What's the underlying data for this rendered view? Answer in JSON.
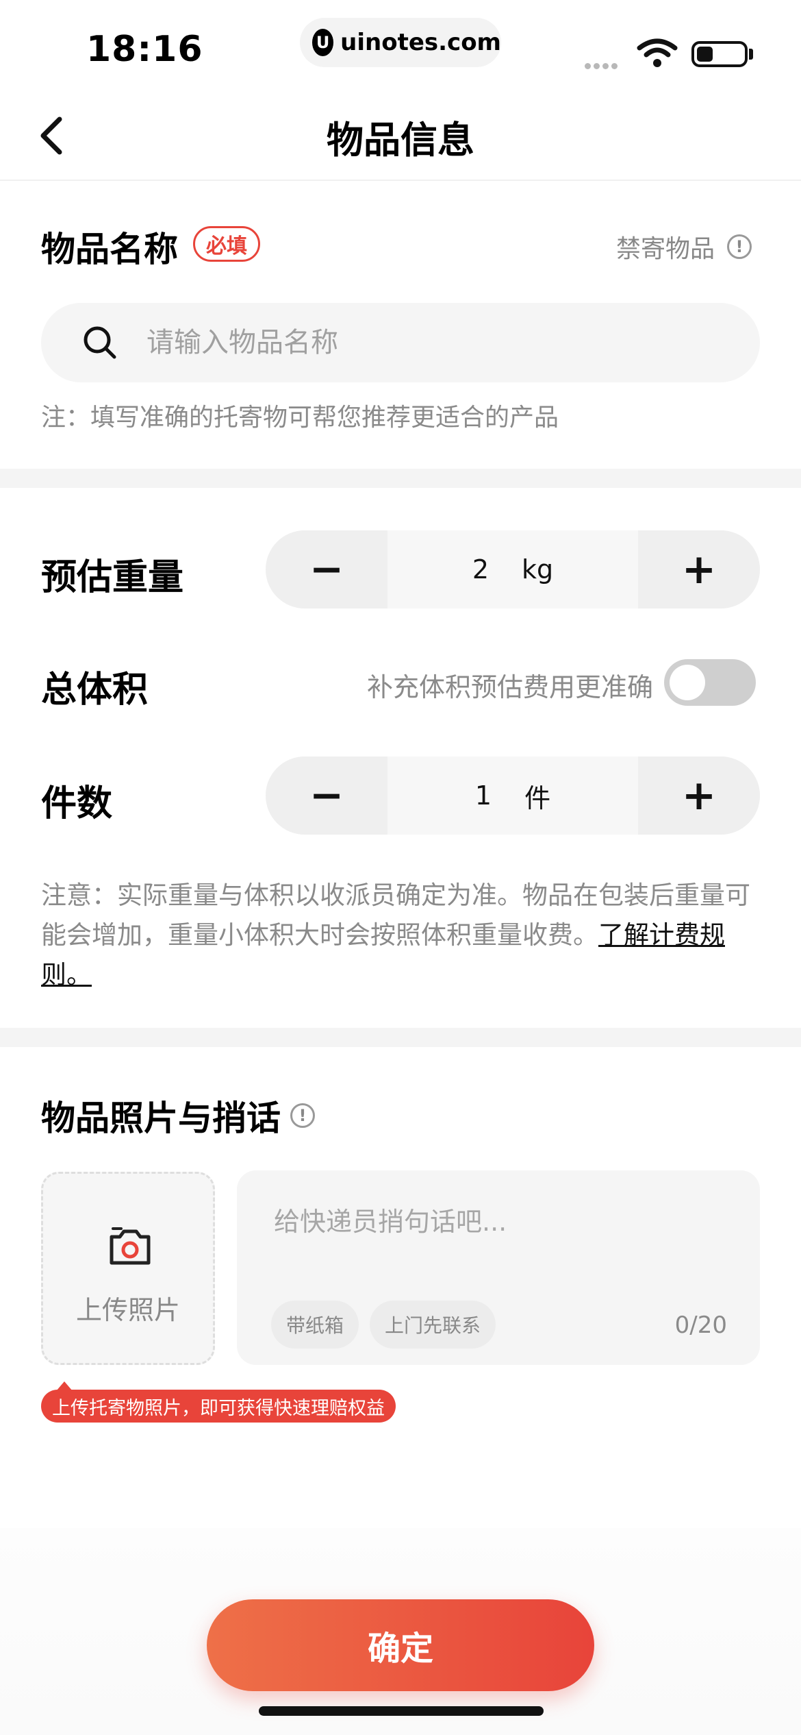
{
  "status_bar": {
    "time": "18:16",
    "url": "uinotes.com",
    "battery_level": 0.35
  },
  "nav": {
    "title": "物品信息"
  },
  "item_name": {
    "label": "物品名称",
    "required_badge": "必填",
    "forbidden_link": "禁寄物品",
    "search_placeholder": "请输入物品名称",
    "note": "注：填写准确的托寄物可帮您推荐更适合的产品"
  },
  "weight": {
    "label": "预估重量",
    "value": "2",
    "unit": "kg",
    "minus": "−",
    "plus": "+"
  },
  "volume": {
    "label": "总体积",
    "hint": "补充体积预估费用更准确",
    "enabled": false
  },
  "count": {
    "label": "件数",
    "value": "1",
    "unit": "件",
    "minus": "−",
    "plus": "+"
  },
  "pricing_note": {
    "text": "注意：实际重量与体积以收派员确定为准。物品在包装后重量可能会增加，重量小体积大时会按照体积重量收费。",
    "link": "了解计费规则。"
  },
  "photo_section": {
    "title": "物品照片与捎话",
    "upload_label": "上传照片",
    "message_placeholder": "给快递员捎句话吧...",
    "chips": [
      "带纸箱",
      "上门先联系"
    ],
    "counter": "0/20",
    "promo": "上传托寄物照片，即可获得快速理赔权益"
  },
  "confirm_button": "确定",
  "colors": {
    "accent": "#e8443a",
    "accent_start": "#ee7048"
  },
  "icons": [
    "back-chevron-icon",
    "search-icon",
    "info-icon",
    "camera-icon",
    "wifi-icon",
    "battery-icon"
  ]
}
